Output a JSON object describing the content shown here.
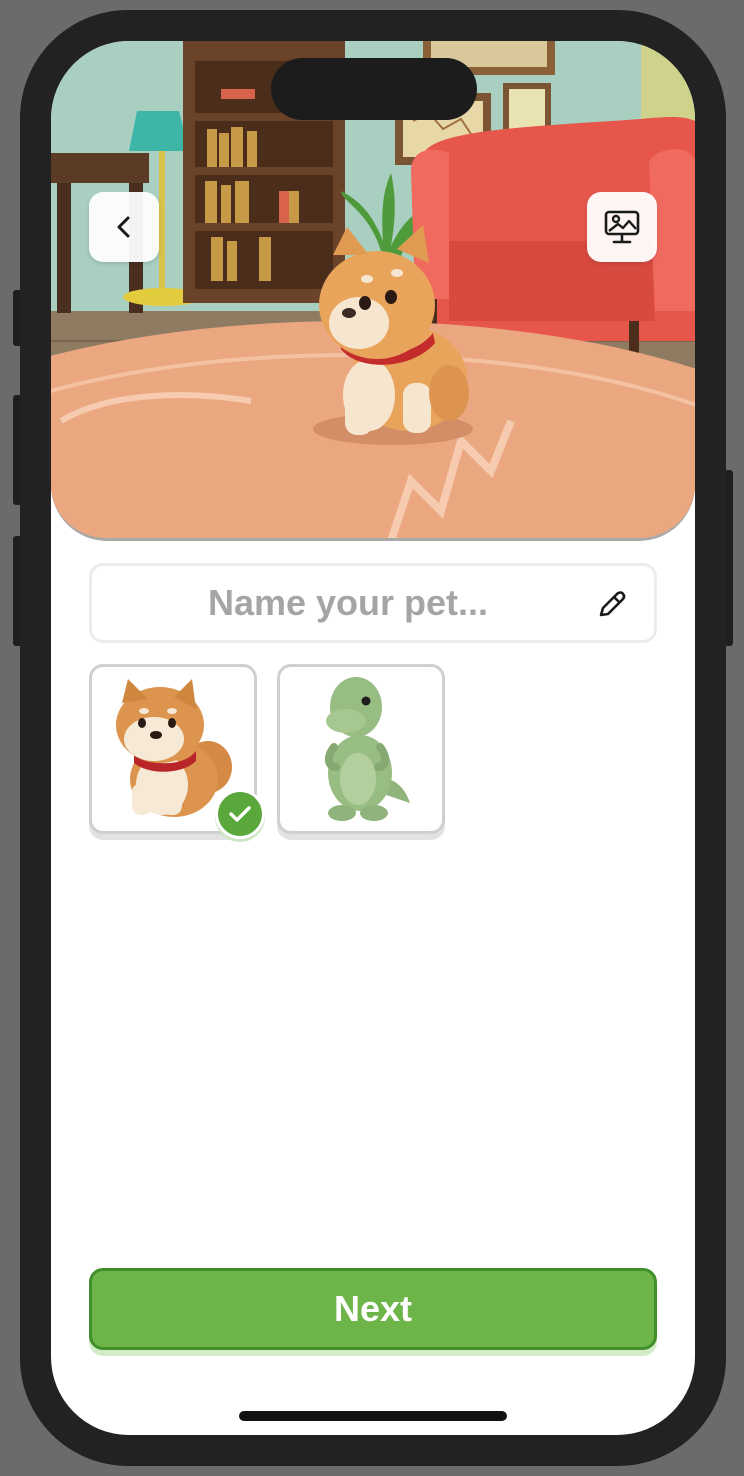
{
  "name_field": {
    "placeholder": "Name your pet..."
  },
  "pets": [
    {
      "name": "shiba-inu",
      "selected": true
    },
    {
      "name": "green-dinosaur",
      "selected": false
    }
  ],
  "next_button": {
    "label": "Next"
  },
  "icons": {
    "back": "chevron-left-icon",
    "background": "screen-image-icon",
    "edit": "pencil-icon",
    "selected": "checkmark-icon"
  },
  "colors": {
    "primary_green": "#6db548",
    "primary_border": "#3f8f2a",
    "placeholder_text": "#a5a5a5",
    "armchair": "#e8564d"
  }
}
